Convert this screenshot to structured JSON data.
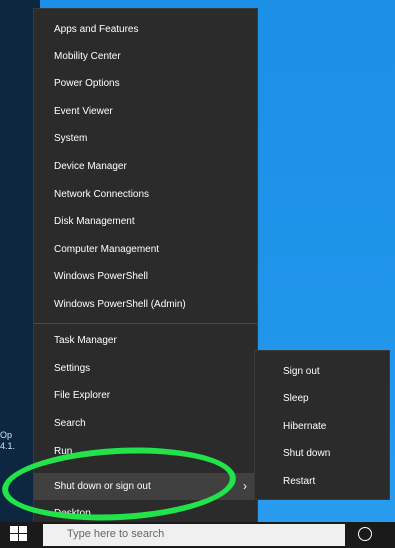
{
  "desktop": {
    "label_line1": "Op",
    "label_line2": "4.1."
  },
  "winx_menu": {
    "group1": [
      {
        "label": "Apps and Features"
      },
      {
        "label": "Mobility Center"
      },
      {
        "label": "Power Options"
      },
      {
        "label": "Event Viewer"
      },
      {
        "label": "System"
      },
      {
        "label": "Device Manager"
      },
      {
        "label": "Network Connections"
      },
      {
        "label": "Disk Management"
      },
      {
        "label": "Computer Management"
      },
      {
        "label": "Windows PowerShell"
      },
      {
        "label": "Windows PowerShell (Admin)"
      }
    ],
    "group2": [
      {
        "label": "Task Manager"
      },
      {
        "label": "Settings"
      },
      {
        "label": "File Explorer"
      },
      {
        "label": "Search"
      },
      {
        "label": "Run"
      },
      {
        "label": "Shut down or sign out"
      },
      {
        "label": "Desktop"
      }
    ],
    "chevron": "›"
  },
  "submenu": {
    "items": [
      {
        "label": "Sign out"
      },
      {
        "label": "Sleep"
      },
      {
        "label": "Hibernate"
      },
      {
        "label": "Shut down"
      },
      {
        "label": "Restart"
      }
    ]
  },
  "taskbar": {
    "search_placeholder": "Type here to search"
  },
  "colors": {
    "menu_bg": "#2b2b2b",
    "highlight": "#404040",
    "annotation": "#22e34a",
    "desktop": "#1e8fe0"
  }
}
